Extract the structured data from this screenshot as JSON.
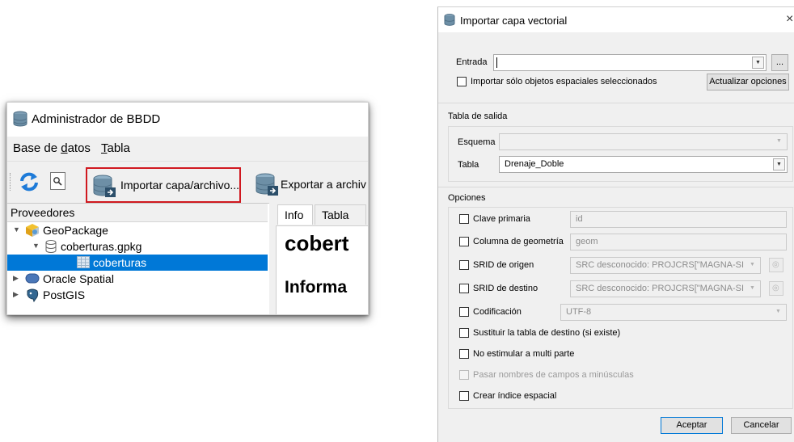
{
  "db_manager": {
    "title": "Administrador de BBDD",
    "menu": [
      {
        "pre": "Base de ",
        "ul": "d",
        "post": "atos"
      },
      {
        "pre": "",
        "ul": "T",
        "post": "abla"
      }
    ],
    "toolbar": {
      "import_label": "Importar capa/archivo...",
      "export_label": "Exportar a archiv"
    },
    "providers_header": "Proveedores",
    "tree": [
      {
        "label": "GeoPackage",
        "icon": "geopackage-icon",
        "expanded": true
      },
      {
        "label": "coberturas.gpkg",
        "icon": "database-icon",
        "expanded": true
      },
      {
        "label": "coberturas",
        "icon": "table-icon",
        "selected": true
      },
      {
        "label": "Oracle Spatial",
        "icon": "oracle-icon",
        "expanded": false
      },
      {
        "label": "PostGIS",
        "icon": "postgis-icon",
        "expanded": false
      }
    ],
    "tabs": [
      "Info",
      "Tabla"
    ],
    "info_title": "cobert",
    "info_subtitle": "Informa",
    "highlight_color": "#d0181f",
    "selection_color": "#0078d7"
  },
  "import_dialog": {
    "title": "Importar capa vectorial",
    "input_label": "Entrada",
    "input_value": "",
    "browse_label": "...",
    "only_selected_label": "Importar sólo objetos espaciales seleccionados",
    "update_options_label": "Actualizar opciones",
    "output_table_title": "Tabla de salida",
    "schema_label": "Esquema",
    "schema_value": "",
    "table_label": "Tabla",
    "table_value": "Drenaje_Doble",
    "options_title": "Opciones",
    "options": {
      "primary_key_label": "Clave primaria",
      "primary_key_value": "id",
      "geom_column_label": "Columna de geometría",
      "geom_column_value": "geom",
      "source_srid_label": "SRID de origen",
      "source_srid_value": "SRC desconocido: PROJCRS[\"MAGNA-SIRG/",
      "target_srid_label": "SRID de destino",
      "target_srid_value": "SRC desconocido: PROJCRS[\"MAGNA-SIRG/",
      "encoding_label": "Codificación",
      "encoding_value": "UTF-8",
      "replace_label": "Sustituir la tabla de destino (si existe)",
      "no_multi_label": "No estimular a multi parte",
      "lowercase_label": "Pasar nombres de campos a minúsculas",
      "spatial_index_label": "Crear índice espacial"
    },
    "ok_label": "Aceptar",
    "cancel_label": "Cancelar",
    "close_glyph": "×"
  }
}
